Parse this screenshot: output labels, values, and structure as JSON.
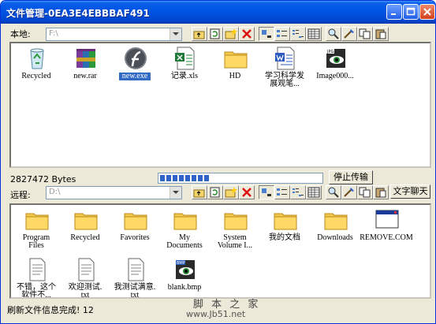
{
  "window": {
    "title": "文件管理-0EA3E4EBBBAF491"
  },
  "local": {
    "label": "本地:",
    "path": "F:\\",
    "files": [
      {
        "name": "Recycled",
        "icon": "recycle-bin-icon"
      },
      {
        "name": "new.rar",
        "icon": "winrar-archive-icon"
      },
      {
        "name": "new.exe",
        "icon": "exe-application-icon",
        "selected": true
      },
      {
        "name": "记录.xls",
        "icon": "excel-file-icon"
      },
      {
        "name": "HD",
        "icon": "folder-icon"
      },
      {
        "name": "学习科学发\n展观笔...",
        "icon": "word-document-icon"
      },
      {
        "name": "Image000...",
        "icon": "image-file-icon"
      }
    ]
  },
  "transfer": {
    "bytes": "2827472 Bytes",
    "progress": 0.3,
    "stop_label": "停止传输"
  },
  "remote": {
    "label": "远程:",
    "path": "D:\\",
    "chat_label": "文字聊天",
    "files": [
      {
        "name": "Program\nFiles",
        "icon": "folder-icon"
      },
      {
        "name": "Recycled",
        "icon": "folder-icon"
      },
      {
        "name": "Favorites",
        "icon": "folder-icon"
      },
      {
        "name": "My\nDocuments",
        "icon": "folder-icon"
      },
      {
        "name": "System\nVolume I...",
        "icon": "folder-icon"
      },
      {
        "name": "我的文档",
        "icon": "folder-icon"
      },
      {
        "name": "Downloads",
        "icon": "folder-icon"
      },
      {
        "name": "REMOVE.COM",
        "icon": "com-program-icon"
      },
      {
        "name": "不错，这个\n软件不...",
        "icon": "text-file-icon"
      },
      {
        "name": "欢迎测试.\ntxt",
        "icon": "text-file-icon"
      },
      {
        "name": "我测试满意.\ntxt",
        "icon": "text-file-icon"
      },
      {
        "name": "blank.bmp",
        "icon": "bitmap-image-icon"
      }
    ]
  },
  "status": {
    "text": "刷新文件信息完成! 12"
  },
  "watermark": {
    "cn": "脚 本 之 家",
    "url": "www.Jb51.net"
  },
  "colors": {
    "titlebar": "#0054e3",
    "selection": "#316ac5",
    "progress": "#2d65c8",
    "face": "#ece9d8"
  }
}
